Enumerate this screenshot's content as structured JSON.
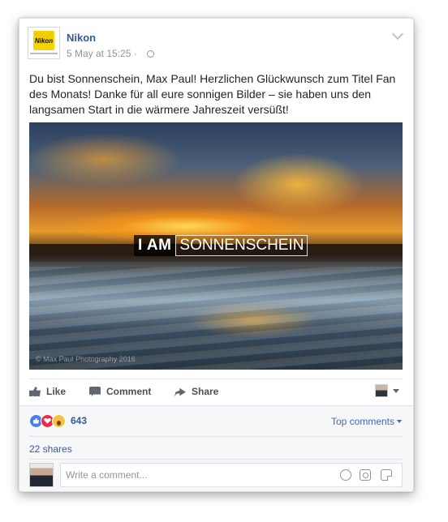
{
  "post": {
    "page_name": "Nikon",
    "logo_text": "Nikon",
    "timestamp": "5 May at 15:25 ·",
    "text": "Du bist Sonnenschein, Max Paul! Herzlichen Glückwunsch zum Titel Fan des Monats! Danke für all eure sonnigen Bilder – sie haben uns den langsamen Start in die wärmere Jahreszeit versüßt!",
    "photo": {
      "banner_left": "I AM",
      "banner_right": "SONNENSCHEIN",
      "credit": "© Max Paul Photography 2016"
    }
  },
  "actions": {
    "like": "Like",
    "comment": "Comment",
    "share": "Share"
  },
  "reactions": {
    "count": "643",
    "types": [
      "like-icon",
      "love-icon",
      "wow-icon"
    ]
  },
  "top_comments": "Top comments",
  "shares": "22 shares",
  "comment_input": {
    "placeholder": "Write a comment..."
  },
  "colors": {
    "link": "#365899",
    "accent": "#4267b2",
    "muted": "#90949c"
  }
}
